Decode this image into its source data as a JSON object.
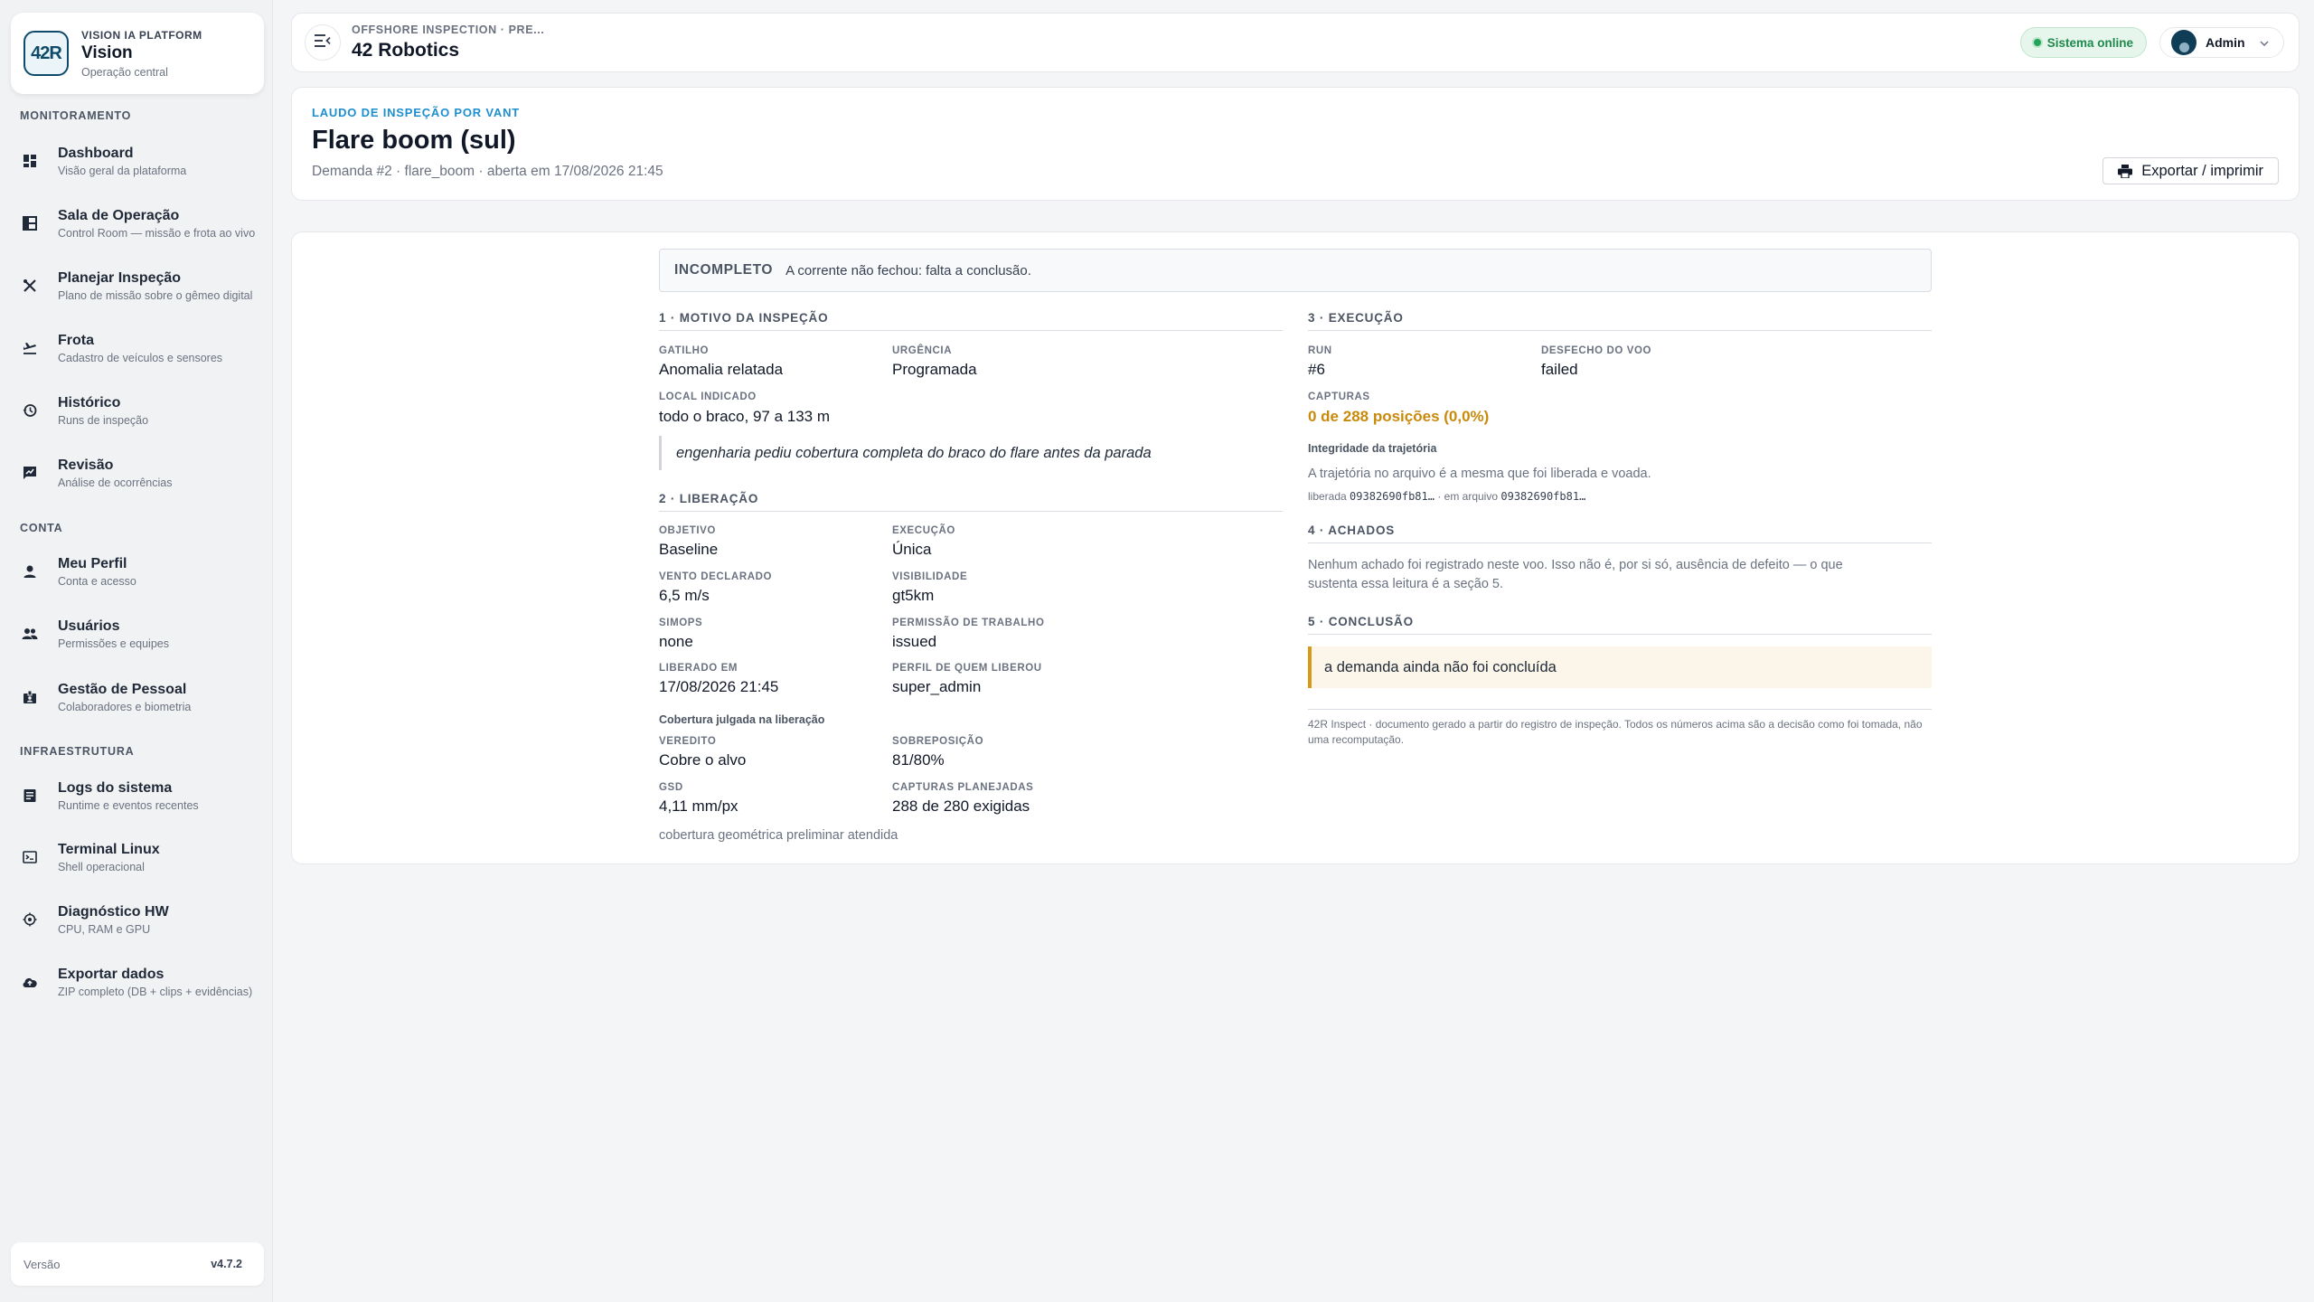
{
  "sidebar": {
    "brand": {
      "logo_text": "42R",
      "subtitle": "VISION IA PLATFORM",
      "title": "Vision",
      "description": "Operação central"
    },
    "sections": [
      {
        "label": "MONITORAMENTO"
      },
      {
        "label": "CONTA"
      },
      {
        "label": "INFRAESTRUTURA"
      }
    ],
    "items": [
      {
        "label": "Dashboard",
        "desc": "Visão geral da plataforma",
        "icon": "dashboard-icon"
      },
      {
        "label": "Sala de Operação",
        "desc": "Control Room — missão e frota ao vivo",
        "icon": "control-room-icon"
      },
      {
        "label": "Planejar Inspeção",
        "desc": "Plano de missão sobre o gêmeo digital",
        "icon": "tools-icon"
      },
      {
        "label": "Frota",
        "desc": "Cadastro de veículos e sensores",
        "icon": "flight-icon"
      },
      {
        "label": "Histórico",
        "desc": "Runs de inspeção",
        "icon": "history-icon"
      },
      {
        "label": "Revisão",
        "desc": "Análise de ocorrências",
        "icon": "review-icon"
      },
      {
        "label": "Meu Perfil",
        "desc": "Conta e acesso",
        "icon": "person-icon"
      },
      {
        "label": "Usuários",
        "desc": "Permissões e equipes",
        "icon": "group-icon"
      },
      {
        "label": "Gestão de Pessoal",
        "desc": "Colaboradores e biometria",
        "icon": "badge-icon"
      },
      {
        "label": "Logs do sistema",
        "desc": "Runtime e eventos recentes",
        "icon": "logs-icon"
      },
      {
        "label": "Terminal Linux",
        "desc": "Shell operacional",
        "icon": "terminal-icon"
      },
      {
        "label": "Diagnóstico HW",
        "desc": "CPU, RAM e GPU",
        "icon": "chip-icon"
      },
      {
        "label": "Exportar dados",
        "desc": "ZIP completo (DB + clips + evidências)",
        "icon": "cloud-upload-icon"
      }
    ],
    "version": {
      "label": "Versão",
      "value": "v4.7.2"
    }
  },
  "topbar": {
    "subtitle": "OFFSHORE INSPECTION · PRE...",
    "title": "42 Robotics",
    "status": "Sistema online",
    "user": "Admin"
  },
  "header": {
    "kicker": "LAUDO DE INSPEÇÃO POR VANT",
    "title": "Flare boom (sul)",
    "meta": "Demanda #2 · flare_boom · aberta em 17/08/2026 21:45",
    "export_label": "Exportar / imprimir"
  },
  "report": {
    "banner": {
      "tag": "INCOMPLETO",
      "message": "A corrente não fechou: falta a conclusão."
    },
    "s1": {
      "title": "1 · MOTIVO DA INSPEÇÃO",
      "gatilho_label": "GATILHO",
      "gatilho": "Anomalia relatada",
      "urgencia_label": "URGÊNCIA",
      "urgencia": "Programada",
      "local_label": "LOCAL INDICADO",
      "local": "todo o braco, 97 a 133 m",
      "quote": "engenharia pediu cobertura completa do braco do flare antes da parada"
    },
    "s2": {
      "title": "2 · LIBERAÇÃO",
      "objetivo_label": "OBJETIVO",
      "objetivo": "Baseline",
      "execucao_label": "EXECUÇÃO",
      "execucao": "Única",
      "vento_label": "VENTO DECLARADO",
      "vento": "6,5 m/s",
      "visibilidade_label": "VISIBILIDADE",
      "visibilidade": "gt5km",
      "simops_label": "SIMOPS",
      "simops": "none",
      "permissao_label": "PERMISSÃO DE TRABALHO",
      "permissao": "issued",
      "liberado_label": "LIBERADO EM",
      "liberado": "17/08/2026 21:45",
      "perfil_label": "PERFIL DE QUEM LIBEROU",
      "perfil": "super_admin",
      "cobertura_title": "Cobertura julgada na liberação",
      "veredito_label": "VEREDITO",
      "veredito": "Cobre o alvo",
      "sobreposicao_label": "SOBREPOSIÇÃO",
      "sobreposicao": "81/80%",
      "gsd_label": "GSD",
      "gsd": "4,11 mm/px",
      "capturas_label": "CAPTURAS PLANEJADAS",
      "capturas": "288 de 280 exigidas",
      "nota": "cobertura geométrica preliminar atendida"
    },
    "s3": {
      "title": "3 · EXECUÇÃO",
      "run_label": "RUN",
      "run": "#6",
      "desfecho_label": "DESFECHO DO VOO",
      "desfecho": "failed",
      "capturas_label": "CAPTURAS",
      "capturas": "0 de 288 posições (0,0%)",
      "integridade_title": "Integridade da trajetória",
      "integridade_text": "A trajetória no arquivo é a mesma que foi liberada e voada.",
      "liberada_label": "liberada",
      "liberada_hash": "09382690fb81…",
      "sep": "·",
      "arquivo_label": "em arquivo",
      "arquivo_hash": "09382690fb81…"
    },
    "s4": {
      "title": "4 · ACHADOS",
      "text": "Nenhum achado foi registrado neste voo. Isso não é, por si só, ausência de defeito — o que sustenta essa leitura é a seção 5."
    },
    "s5": {
      "title": "5 · CONCLUSÃO",
      "callout": "a demanda ainda não foi concluída"
    },
    "footer": "42R Inspect · documento gerado a partir do registro de inspeção. Todos os números acima são a decisão como foi tomada, não uma recomputação."
  },
  "colors": {
    "accent": "#1d8fd1",
    "status_online": "#1f8a4c",
    "warning": "#c98a0c",
    "callout_bg": "#fbf6e9"
  }
}
